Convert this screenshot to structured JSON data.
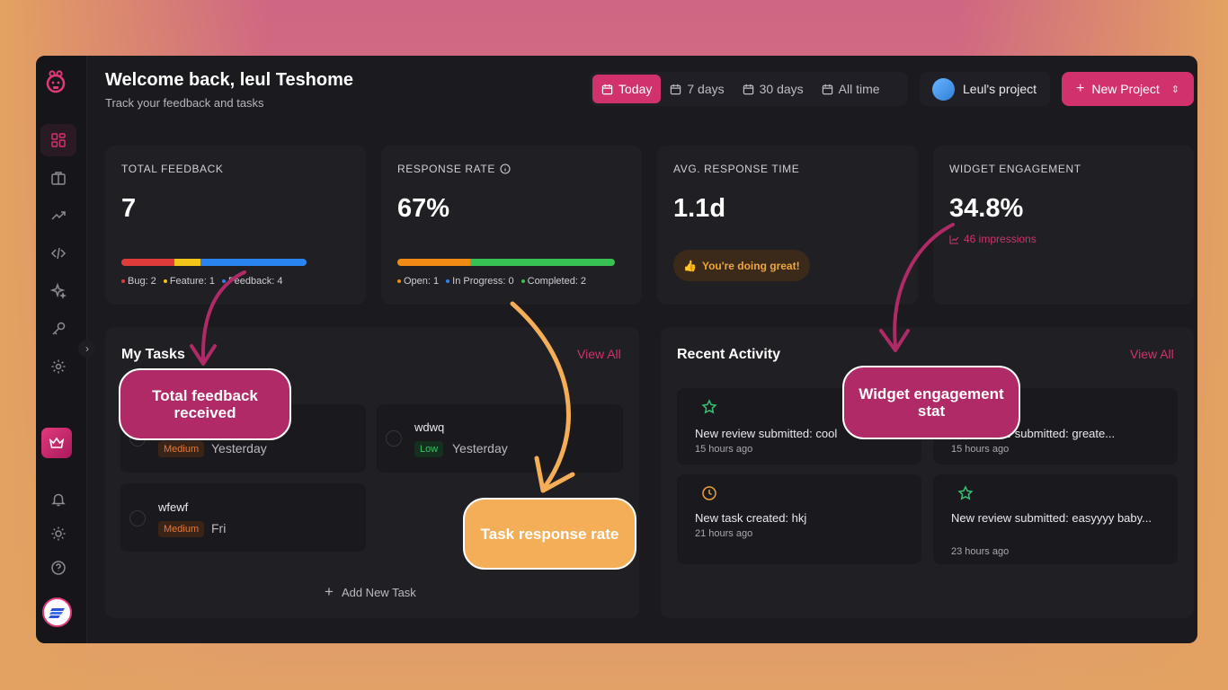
{
  "header": {
    "title": "Welcome back, leul Teshome",
    "subtitle": "Track your feedback and tasks"
  },
  "ranges": [
    {
      "label": "Today",
      "active": true
    },
    {
      "label": "7 days",
      "active": false
    },
    {
      "label": "30 days",
      "active": false
    },
    {
      "label": "All time",
      "active": false
    }
  ],
  "project": {
    "label": "Leul's project"
  },
  "new_project": {
    "label": "New Project"
  },
  "stats": {
    "total_feedback": {
      "label": "TOTAL FEEDBACK",
      "value": "7",
      "breakdown": [
        {
          "label": "Bug: 2",
          "count": 2,
          "color": "#e03b3b"
        },
        {
          "label": "Feature: 1",
          "count": 1,
          "color": "#f2c318"
        },
        {
          "label": "Feedback: 4",
          "count": 4,
          "color": "#2a84f0"
        }
      ]
    },
    "response_rate": {
      "label": "RESPONSE RATE",
      "value": "67%",
      "breakdown": [
        {
          "label": "Open: 1",
          "count": 1,
          "color": "#f08a12"
        },
        {
          "label": "In Progress: 0",
          "count": 0,
          "color": "#2a84f0"
        },
        {
          "label": "Completed: 2",
          "count": 2,
          "color": "#37c152"
        }
      ]
    },
    "avg_response": {
      "label": "AVG. RESPONSE TIME",
      "value": "1.1d",
      "badge": "You're doing great!"
    },
    "widget_engagement": {
      "label": "WIDGET ENGAGEMENT",
      "value": "34.8%",
      "impressions": "46 impressions"
    }
  },
  "tasks": {
    "title": "My Tasks",
    "view_all": "View All",
    "items": [
      {
        "name": "",
        "priority": "Medium",
        "due": "Yesterday"
      },
      {
        "name": "wdwq",
        "priority": "Low",
        "due": "Yesterday"
      },
      {
        "name": "wfewf",
        "priority": "Medium",
        "due": "Fri"
      }
    ],
    "add_label": "Add New Task"
  },
  "activity": {
    "title": "Recent Activity",
    "view_all": "View All",
    "items": [
      {
        "icon": "star-icon",
        "text": "New review submitted: cool",
        "time": "15 hours ago"
      },
      {
        "icon": "star-icon",
        "text": "New review submitted: greate...",
        "time": "15 hours ago"
      },
      {
        "icon": "clock-icon",
        "text": "New task created: hkj",
        "time": "21 hours ago"
      },
      {
        "icon": "star-icon",
        "text": "New review submitted: easyyyy baby...",
        "time": "23 hours ago"
      }
    ]
  },
  "annotations": {
    "total_feedback": "Total feedback received",
    "task_response": "Task response rate",
    "widget_engagement": "Widget engagement stat"
  },
  "colors": {
    "accent": "#d1326e",
    "card": "#1f1f24",
    "callout_pink": "#b02a68",
    "callout_orange": "#f5ae58"
  }
}
